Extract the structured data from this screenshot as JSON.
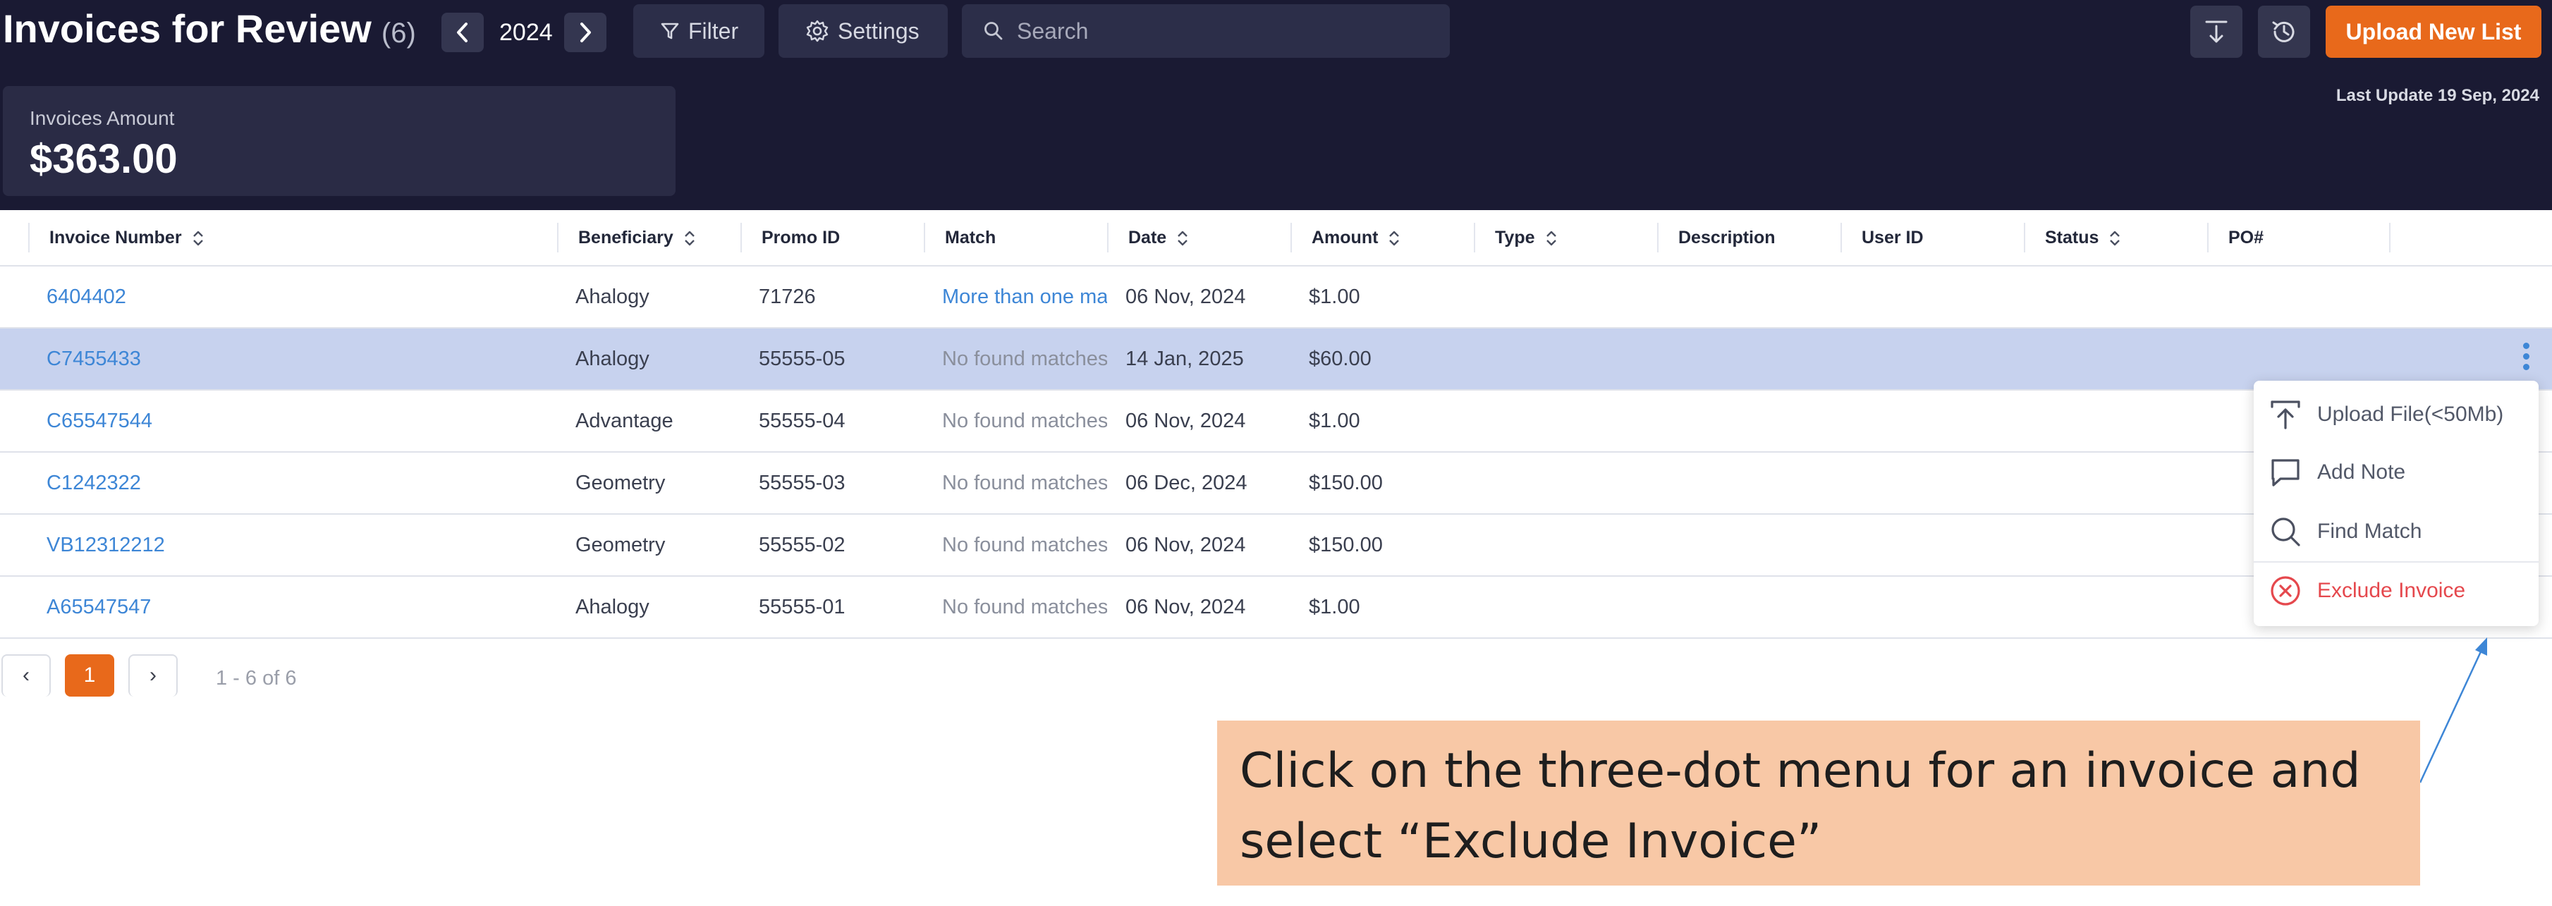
{
  "header": {
    "title": "Invoices for Review",
    "count": "(6)",
    "year": "2024",
    "year_prev_icon": "chevron-left-icon",
    "year_next_icon": "chevron-right-icon",
    "filter_label": "Filter",
    "settings_label": "Settings",
    "search_placeholder": "Search",
    "upload_label": "Upload New List",
    "last_update": "Last Update 19 Sep, 2024"
  },
  "summary": {
    "label": "Invoices Amount",
    "value": "$363.00"
  },
  "table": {
    "columns": [
      "Invoice Number",
      "Beneficiary",
      "Promo ID",
      "Match",
      "Date",
      "Amount",
      "Type",
      "Description",
      "User ID",
      "Status",
      "PO#"
    ],
    "rows": [
      {
        "invoice": "6404402",
        "beneficiary": "Ahalogy",
        "promo": "71726",
        "match": "More than one match",
        "date": "06 Nov, 2024",
        "amount": "$1.00"
      },
      {
        "invoice": "C7455433",
        "beneficiary": "Ahalogy",
        "promo": "55555-05",
        "match": "No found matches",
        "date": "14 Jan, 2025",
        "amount": "$60.00"
      },
      {
        "invoice": "C65547544",
        "beneficiary": "Advantage",
        "promo": "55555-04",
        "match": "No found matches",
        "date": "06 Nov, 2024",
        "amount": "$1.00"
      },
      {
        "invoice": "C1242322",
        "beneficiary": "Geometry",
        "promo": "55555-03",
        "match": "No found matches",
        "date": "06 Dec, 2024",
        "amount": "$150.00"
      },
      {
        "invoice": "VB12312212",
        "beneficiary": "Geometry",
        "promo": "55555-02",
        "match": "No found matches",
        "date": "06 Nov, 2024",
        "amount": "$150.00"
      },
      {
        "invoice": "A65547547",
        "beneficiary": "Ahalogy",
        "promo": "55555-01",
        "match": "No found matches",
        "date": "06 Nov, 2024",
        "amount": "$1.00"
      }
    ]
  },
  "pagination": {
    "prev": "‹",
    "current": "1",
    "next": "›",
    "range": "1 - 6 of 6"
  },
  "menu": {
    "upload_file": "Upload File(<50Mb)",
    "add_note": "Add Note",
    "find_match": "Find Match",
    "exclude_invoice": "Exclude Invoice"
  },
  "callout": {
    "text": "Click on the three-dot menu for an invoice and select “Exclude Invoice”"
  },
  "colors": {
    "header_bg": "#1a1a33",
    "accent": "#e8691b",
    "link": "#3d86d6",
    "selected_row": "#c7d2ee",
    "danger": "#e5484d",
    "callout_bg": "#f8c8a6"
  }
}
